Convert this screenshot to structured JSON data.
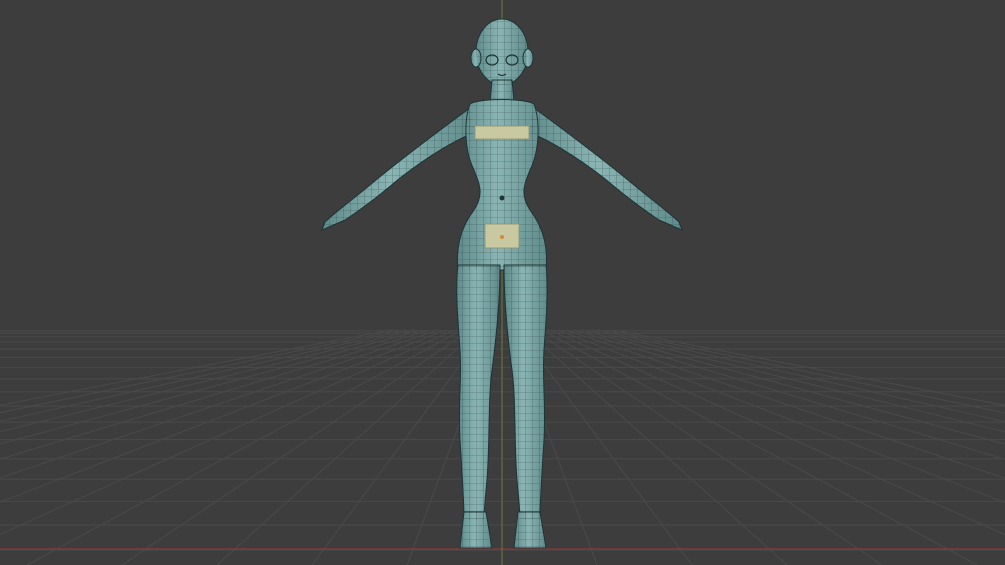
{
  "viewport": {
    "background": "#3d3d3d",
    "floor_grid": true,
    "grid_color": "#4a4a4a",
    "x_axis_color": "#8a3a3a",
    "z_axis_color": "#6b7a3a"
  },
  "model": {
    "shading": "solid",
    "wireframe_overlay": true,
    "mesh_color": "#7faaaa",
    "wire_color": "#1e3434",
    "censor_color": "#c8c9a0",
    "pose": "A-pose"
  }
}
